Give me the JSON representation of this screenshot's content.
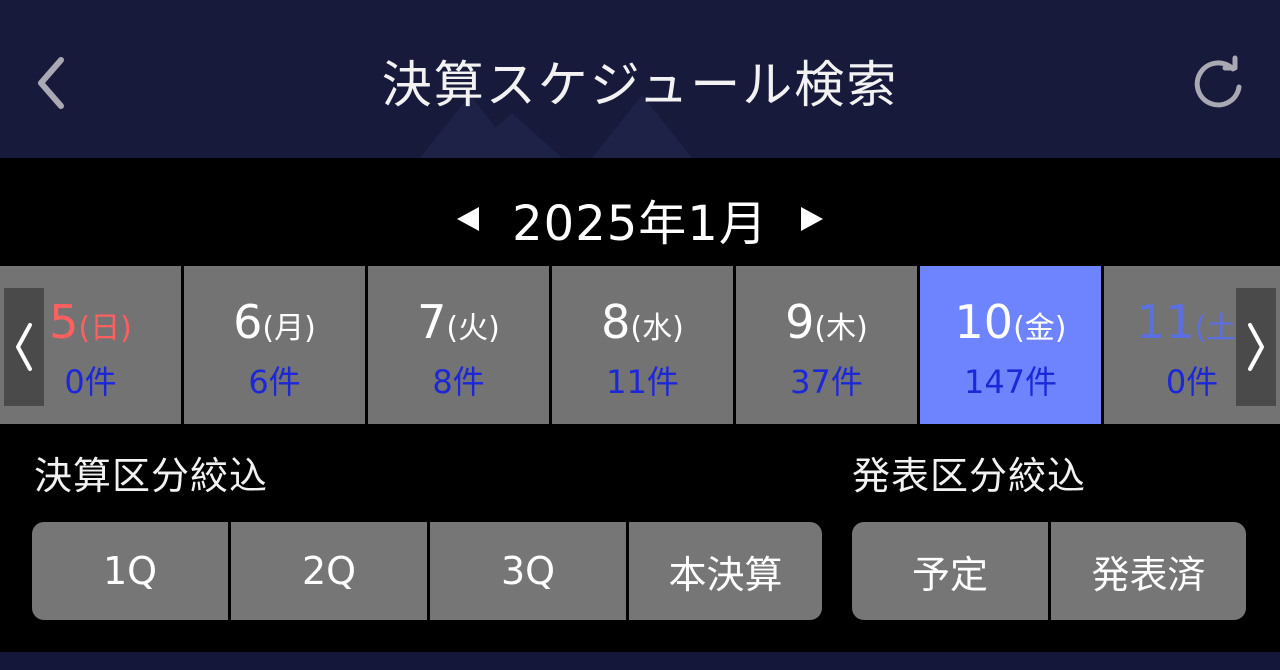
{
  "header": {
    "title": "決算スケジュール検索",
    "back_icon": "chevron-left-icon",
    "reload_icon": "refresh-icon"
  },
  "month_nav": {
    "label": "2025年1月",
    "prev_icon": "triangle-left-icon",
    "next_icon": "triangle-right-icon"
  },
  "days": [
    {
      "day": "5",
      "dow": "(日)",
      "count": "0件",
      "type": "sunday",
      "selected": false
    },
    {
      "day": "6",
      "dow": "(月)",
      "count": "6件",
      "type": "weekday",
      "selected": false
    },
    {
      "day": "7",
      "dow": "(火)",
      "count": "8件",
      "type": "weekday",
      "selected": false
    },
    {
      "day": "8",
      "dow": "(水)",
      "count": "11件",
      "type": "weekday",
      "selected": false
    },
    {
      "day": "9",
      "dow": "(木)",
      "count": "37件",
      "type": "weekday",
      "selected": false
    },
    {
      "day": "10",
      "dow": "(金)",
      "count": "147件",
      "type": "weekday",
      "selected": true
    },
    {
      "day": "11",
      "dow": "(土)",
      "count": "0件",
      "type": "saturday",
      "selected": false
    }
  ],
  "strip_nav": {
    "prev_icon": "chevron-left-icon",
    "next_icon": "chevron-right-icon"
  },
  "filters": {
    "settlement": {
      "label": "決算区分絞込",
      "options": [
        "1Q",
        "2Q",
        "3Q",
        "本決算"
      ]
    },
    "announcement": {
      "label": "発表区分絞込",
      "options": [
        "予定",
        "発表済"
      ]
    }
  },
  "colors": {
    "header_bg": "#171a3b",
    "cell_bg": "#737373",
    "selected_bg": "#6e84ff",
    "count_text": "#1c28d8",
    "sunday_text": "#ff5f5f",
    "saturday_text": "#5c6fe0",
    "button_bg": "#767676"
  }
}
